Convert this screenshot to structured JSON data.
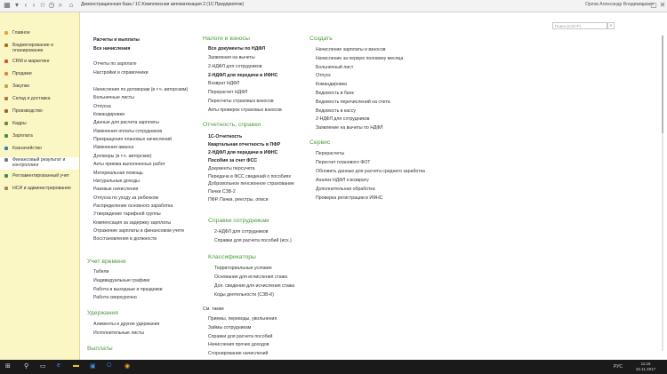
{
  "window": {
    "title": "Демонстрационная база / 1С:Комплексная автоматизация 2  (1С:Предприятие)",
    "user": "Орлов Александр Владимирович"
  },
  "search": {
    "placeholder": "Поиск (Ctrl+F)"
  },
  "sidebar": {
    "items": [
      {
        "label": "Главное",
        "color": "#e9a53b"
      },
      {
        "label": "Бюджетирование и планирование",
        "color": "#b46b2f"
      },
      {
        "label": "CRM и маркетинг",
        "color": "#d9543b"
      },
      {
        "label": "Продажи",
        "color": "#e7893b"
      },
      {
        "label": "Закупки",
        "color": "#c7a63b"
      },
      {
        "label": "Склад и доставка",
        "color": "#a87a3b"
      },
      {
        "label": "Производство",
        "color": "#8f6a3b"
      },
      {
        "label": "Кадры",
        "color": "#6b8f3b"
      },
      {
        "label": "Зарплата",
        "color": "#4f8f3b"
      },
      {
        "label": "Казначейство",
        "color": "#3b7fb4"
      },
      {
        "label": "Финансовый результат и контроллинг",
        "color": "#7a7a7a"
      },
      {
        "label": "Регламентированный учет",
        "color": "#3b8f6b"
      },
      {
        "label": "НСИ и администрирование",
        "color": "#9a8a5b"
      }
    ]
  },
  "col1": {
    "group1": [
      "Расчеты и выплаты",
      "Все начисления"
    ],
    "group2": [
      "Отчеты по зарплате",
      "Настройки и справочники"
    ],
    "group3": [
      "Начисления по договорам (в т.ч. авторским)",
      "Больничные листы",
      "Отпуска",
      "Командировки",
      "Данные для расчета зарплаты",
      "Изменения оплаты сотрудников",
      "Прекращения плановых начислений",
      "Изменения аванса",
      "Договоры (в т.ч. авторские)",
      "Акты приема выполненных работ",
      "Материальная помощь",
      "Натуральные доходы",
      "Разовые начисления",
      "Отпуска по уходу за ребенком",
      "Распределение основного заработка",
      "Утверждение тарифной группы",
      "Компенсация за задержку зарплаты",
      "Отражение зарплаты в финансовом учете",
      "Восстановления в должности"
    ],
    "time_title": "Учет времени",
    "time_items": [
      "Табели",
      "Индивидуальные графики",
      "Работа в выходные и праздники",
      "Работа сверхурочно"
    ],
    "deductions_title": "Удержания",
    "deductions_items": [
      "Алименты и другие удержания",
      "Исполнительные листы"
    ],
    "payments_title": "Выплаты"
  },
  "col2": {
    "taxes_title": "Налоги и взносы",
    "taxes_items": [
      "Все документы по НДФЛ",
      "Заявления на вычеты",
      "2-НДФЛ для сотрудников",
      "2-НДФЛ для передачи в ИФНС",
      "Возврат НДФЛ",
      "Перерасчет НДФЛ",
      "Пересчеты страховых взносов",
      "Акты проверок страховых взносов"
    ],
    "reports_title": "Отчетность, справки",
    "reports_items": [
      "1С-Отчетность",
      "Квартальная отчетность в ПФР",
      "2-НДФЛ для передачи в ИФНС",
      "Пособия за счет ФСС",
      "Документы персучета",
      "Передача в ФСС сведений о пособиях",
      "Добровольное пенсионное страхование",
      "Пачки СЗВ-2",
      "ПФР. Пачки, реестры, описи"
    ],
    "certs_title": "Справки сотрудникам",
    "certs_items": [
      "2-НДФЛ для сотрудников",
      "Справки для расчета пособий (исх.)"
    ],
    "class_title": "Классификаторы",
    "class_items": [
      "Территориальные условия",
      "Основания для исчисления стажа",
      "Доп. сведения для исчисления стажа",
      "Коды деятельности (СЗВ-К)"
    ],
    "see_also_title": "См. также",
    "see_also_items": [
      "Приемы, переводы, увольнения",
      "Займы сотрудникам",
      "Справки для расчета пособий",
      "Начисления прочих доходов",
      "Сторнирование начислений"
    ]
  },
  "col3": {
    "create_title": "Создать",
    "create_items": [
      "Начисление зарплаты и взносов",
      "Начисление за первую половину месяца",
      "Больничный лист",
      "Отпуск",
      "Командировка",
      "Ведомость в банк",
      "Ведомость перечислений на счета",
      "Ведомость в кассу",
      "2-НДФЛ для сотрудников",
      "Заявление на вычеты по НДФЛ"
    ],
    "service_title": "Сервис",
    "service_items": [
      "Перерасчеты",
      "Пересчет планового ФОТ",
      "Обновить данные для расчета среднего заработка",
      "Анализ НДФЛ к возврату",
      "Дополнительная обработка",
      "Проверка регистрации в ИФНС"
    ]
  },
  "taskbar": {
    "lang": "РУС",
    "time": "11:16",
    "date": "22.11.2017"
  }
}
